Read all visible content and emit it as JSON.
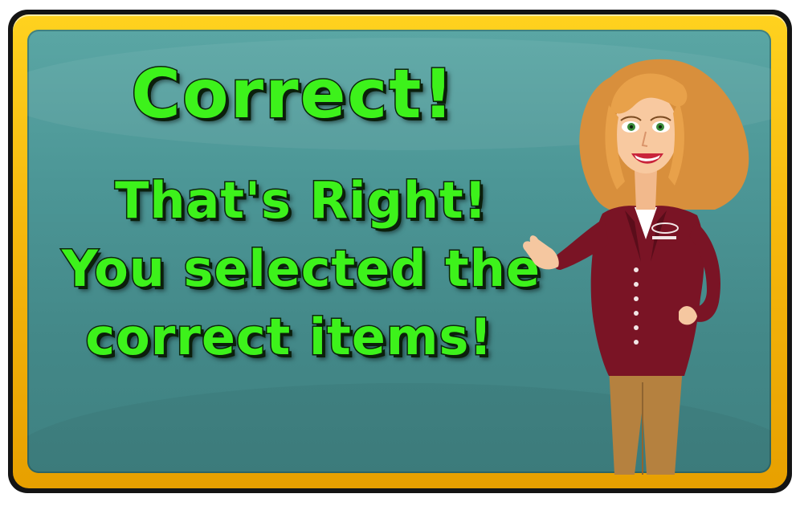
{
  "feedback": {
    "headline": "Correct!",
    "message_lines": [
      "That's Right!",
      "You selected the",
      "correct items!"
    ]
  },
  "presenter": {
    "icon": "presenter-woman-illustration"
  },
  "colors": {
    "text_green": "#3df21b",
    "board_teal": "#4c9696",
    "frame_gold": "#f6b80d",
    "blazer_maroon": "#7a1425",
    "pants_tan": "#b5813f",
    "hair_blonde": "#e8a14a"
  }
}
